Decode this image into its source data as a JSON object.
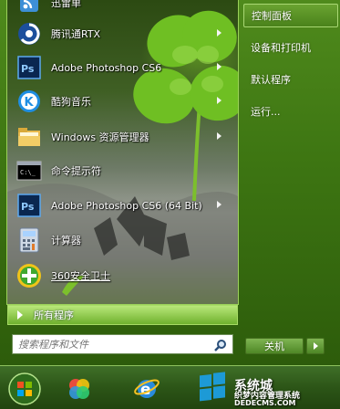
{
  "start_menu": {
    "programs": [
      {
        "label": "迅雷单",
        "icon": "rss-feed-icon",
        "has_submenu": false
      },
      {
        "label": "腾讯通RTX",
        "icon": "rtx-icon",
        "has_submenu": true
      },
      {
        "label": "Adobe Photoshop CS6",
        "icon": "photoshop-icon",
        "has_submenu": true
      },
      {
        "label": "酷狗音乐",
        "icon": "kugou-music-icon",
        "has_submenu": true
      },
      {
        "label": "Windows 资源管理器",
        "icon": "folder-icon",
        "has_submenu": true
      },
      {
        "label": "命令提示符",
        "icon": "cmd-icon",
        "has_submenu": false
      },
      {
        "label": "Adobe Photoshop CS6 (64 Bit)",
        "icon": "photoshop-icon",
        "has_submenu": true
      },
      {
        "label": "计算器",
        "icon": "calculator-icon",
        "has_submenu": false
      },
      {
        "label": "360安全卫士",
        "icon": "360-safe-icon",
        "has_submenu": false
      }
    ],
    "all_programs_label": "所有程序",
    "search": {
      "placeholder": "搜索程序和文件",
      "value": ""
    },
    "right_links": [
      {
        "label": "控制面板",
        "active": true
      },
      {
        "label": "设备和打印机",
        "active": false
      },
      {
        "label": "默认程序",
        "active": false
      },
      {
        "label": "运行...",
        "active": false
      }
    ],
    "shutdown_label": "关机"
  },
  "taskbar": {
    "items": [
      "start-orb-icon",
      "colorful-app-icon",
      "internet-explorer-icon"
    ]
  },
  "watermark": {
    "line1": "系统城",
    "line2": "织梦内容管理系统",
    "line3": "DEDECMS.COM"
  },
  "colors": {
    "frame": "#3d7512",
    "highlight": "#6aa331",
    "all_programs_bar": "#8fc94b"
  }
}
